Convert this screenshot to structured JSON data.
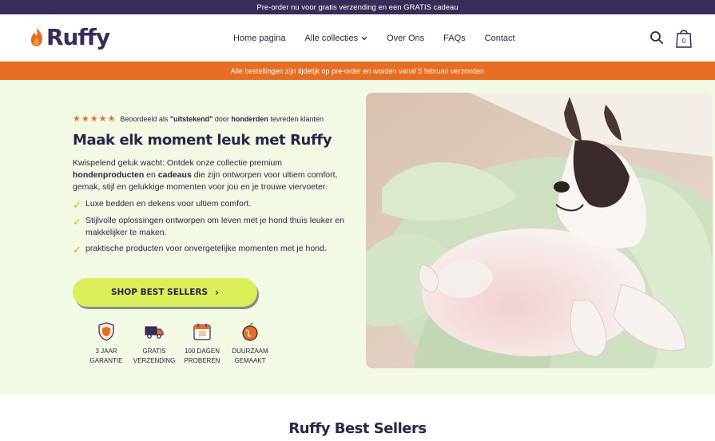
{
  "topbar": {
    "text": "Pre-order nu voor gratis verzending en een GRATIS cadeau"
  },
  "header": {
    "logo": "Ruffy",
    "nav": [
      {
        "label": "Home pagina"
      },
      {
        "label": "Alle collecties"
      },
      {
        "label": "Over Ons"
      },
      {
        "label": "FAQs"
      },
      {
        "label": "Contact"
      }
    ],
    "icons": [
      "search-icon",
      "shopping-bag-icon"
    ],
    "cart_count": "0"
  },
  "announcement": {
    "text": "Alle bestellingen zijn tijdelijk op pre-order en worden vanaf 5 februari verzonden"
  },
  "hero": {
    "rating": {
      "stars": 5,
      "prefix": "Beoordeeld als ",
      "quality": "\"uitstekend\"",
      "middle": " door ",
      "count": "honderden",
      "suffix": " tevreden klanten"
    },
    "title": "Maak elk moment leuk met Ruffy",
    "desc_1": "Kwispelend geluk wacht: Ontdek onze collectie premium ",
    "desc_b1": "hondenproducten",
    "desc_2": " en ",
    "desc_b2": "cadeaus",
    "desc_3": " die zijn ontworpen voor ultiem comfort, gemak, stijl en gelukkige momenten voor jou en je trouwe viervoeter.",
    "bullets": [
      "Luxe bedden en dekens voor ultiem comfort.",
      "Stijlvolle oplossingen ontworpen om leven met je hond thuis leuker en makkelijker te maken.",
      "praktische producten voor onvergetelijke momenten met je hond."
    ],
    "cta": "SHOP BEST SELLERS",
    "usps": [
      {
        "line1": "3 JAAR",
        "line2": "GARANTIE",
        "icon": "shield-icon"
      },
      {
        "line1": "GRATIS",
        "line2": "VERZENDING",
        "icon": "truck-icon"
      },
      {
        "line1": "100 DAGEN",
        "line2": "PROBEREN",
        "icon": "calendar-icon"
      },
      {
        "line1": "DUURZAAM",
        "line2": "GEMAAKT",
        "icon": "globe-icon"
      }
    ]
  },
  "bestsellers": {
    "title": "Ruffy Best Sellers"
  },
  "colors": {
    "brand": "#3a2c59",
    "accent": "#e86d24",
    "cta": "#d9ee58",
    "hero_bg": "#f2fae6"
  }
}
